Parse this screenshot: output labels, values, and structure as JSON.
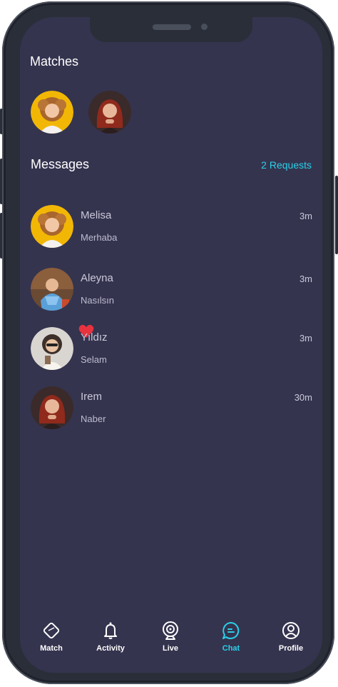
{
  "matches": {
    "title": "Matches",
    "items": [
      {
        "avatar": "curly-hair-woman-yellow-bg"
      },
      {
        "avatar": "red-hair-woman-dark-bg"
      }
    ]
  },
  "messages": {
    "title": "Messages",
    "requests_link": "2 Requests",
    "items": [
      {
        "name": "Melisa",
        "preview": "Merhaba",
        "time": "3m"
      },
      {
        "name": "Aleyna",
        "preview": "Nasılsın",
        "time": "3m"
      },
      {
        "name": "Yıldız",
        "preview": "Selam",
        "time": "3m",
        "badge": "heart-icon"
      },
      {
        "name": "Irem",
        "preview": "Naber",
        "time": "30m"
      }
    ]
  },
  "tabbar": {
    "active": "Chat",
    "tabs": [
      {
        "label": "Match",
        "icon": "diamond-card-icon"
      },
      {
        "label": "Activity",
        "icon": "bell-icon"
      },
      {
        "label": "Live",
        "icon": "webcam-icon"
      },
      {
        "label": "Chat",
        "icon": "chat-bubble-icon"
      },
      {
        "label": "Profile",
        "icon": "user-icon"
      }
    ]
  },
  "colors": {
    "screen_bg": "#35344f",
    "frame": "#2a2e39",
    "accent": "#2ad0e8",
    "text_primary": "#ffffff",
    "text_secondary": "#c9c8d9",
    "heart": "#e8333f"
  }
}
